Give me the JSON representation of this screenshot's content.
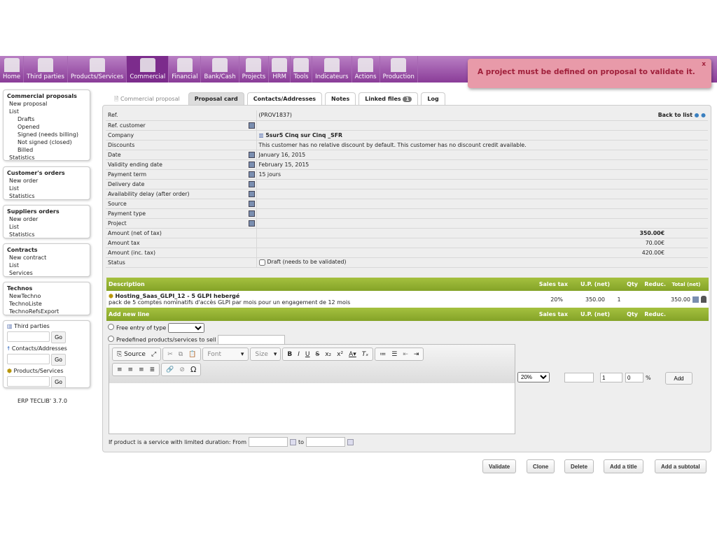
{
  "nav": [
    "Home",
    "Third parties",
    "Products/Services",
    "Commercial",
    "Financial",
    "Bank/Cash",
    "Projects",
    "HRM",
    "Tools",
    "Indicateurs",
    "Actions",
    "Production"
  ],
  "notice": {
    "text": "A project must be defined on proposal to validate it.",
    "close": "x"
  },
  "sidebar": {
    "proposals": {
      "title": "Commercial proposals",
      "items": [
        "New proposal",
        "List"
      ],
      "sub": [
        "Drafts",
        "Opened",
        "Signed (needs billing)",
        "Not signed (closed)",
        "Billed"
      ],
      "last": "Statistics"
    },
    "orders": {
      "title": "Customer's orders",
      "items": [
        "New order",
        "List",
        "Statistics"
      ]
    },
    "suppliers": {
      "title": "Suppliers orders",
      "items": [
        "New order",
        "List",
        "Statistics"
      ]
    },
    "contracts": {
      "title": "Contracts",
      "items": [
        "New contract",
        "List",
        "Services"
      ]
    },
    "technos": {
      "title": "Technos",
      "items": [
        "NewTechno",
        "TechnoListe",
        "TechnoRefsExport"
      ]
    },
    "search": {
      "labels": [
        "Third parties",
        "Contacts/Addresses",
        "Products/Services"
      ],
      "go": "Go"
    },
    "version": "ERP TECLIB' 3.7.0"
  },
  "tabs": {
    "head": "Commercial proposal",
    "items": [
      "Proposal card",
      "Contacts/Addresses",
      "Notes",
      "Linked files",
      "Log"
    ],
    "linked_count": "1"
  },
  "card": {
    "back": "Back to list",
    "rows": [
      [
        "Ref.",
        "(PROV1837)"
      ],
      [
        "Ref. customer",
        ""
      ],
      [
        "Company",
        "5sur5 Cinq sur Cinq _SFR"
      ],
      [
        "Discounts",
        "This customer has no relative discount by default. This customer has no discount credit available."
      ],
      [
        "Date",
        "January 16, 2015"
      ],
      [
        "Validity ending date",
        "February 15, 2015"
      ],
      [
        "Payment term",
        "15 jours"
      ],
      [
        "Delivery date",
        ""
      ],
      [
        "Availability delay (after order)",
        ""
      ],
      [
        "Source",
        ""
      ],
      [
        "Payment type",
        ""
      ],
      [
        "Project",
        ""
      ],
      [
        "Amount (net of tax)",
        "350.00€"
      ],
      [
        "Amount tax",
        "70.00€"
      ],
      [
        "Amount (inc. tax)",
        "420.00€"
      ],
      [
        "Status",
        "Draft (needs to be validated)"
      ]
    ]
  },
  "lines": {
    "headers": {
      "desc": "Description",
      "tax": "Sales tax",
      "up": "U.P. (net)",
      "qty": "Qty",
      "reduc": "Reduc.",
      "total": "Total (net)"
    },
    "line": {
      "title": "Hosting_Saas_GLPI_12 - 5 GLPI hebergé",
      "desc": "pack de 5 comptes nominatifs d'accès GLPI par mois pour un engagement de 12 mois",
      "tax": "20%",
      "up": "350.00",
      "qty": "1",
      "total": "350.00"
    },
    "add": {
      "title": "Add new line",
      "free": "Free entry of type",
      "predef": "Predefined products/services to sell",
      "tax": "20%",
      "qty": "1",
      "reduc": "0",
      "pct": "%",
      "add": "Add",
      "duration": "If product is a service with limited duration: From",
      "to": "to"
    }
  },
  "editor": {
    "source": "Source",
    "font": "Font",
    "size": "Size"
  },
  "actions": [
    "Validate",
    "Clone",
    "Delete",
    "Add a title",
    "Add a subtotal"
  ]
}
